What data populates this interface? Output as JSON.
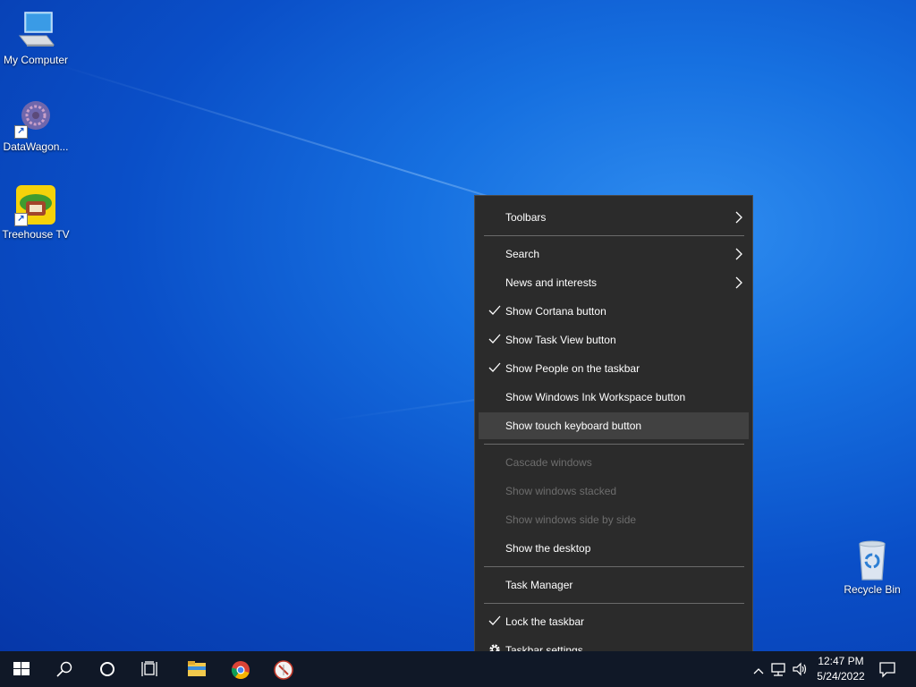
{
  "desktop": {
    "icons": [
      {
        "label": "My Computer",
        "icon": "computer-icon"
      },
      {
        "label": "DataWagon...",
        "icon": "datawagon-icon"
      },
      {
        "label": "Treehouse TV",
        "icon": "treehouse-tv-icon"
      },
      {
        "label": "Recycle Bin",
        "icon": "recycle-bin-icon"
      }
    ]
  },
  "context_menu": {
    "items": [
      {
        "label": "Toolbars",
        "submenu": true
      },
      {
        "label": "Search",
        "submenu": true
      },
      {
        "label": "News and interests",
        "submenu": true
      },
      {
        "label": "Show Cortana button",
        "checked": true
      },
      {
        "label": "Show Task View button",
        "checked": true
      },
      {
        "label": "Show People on the taskbar",
        "checked": true
      },
      {
        "label": "Show Windows Ink Workspace button"
      },
      {
        "label": "Show touch keyboard button",
        "highlighted": true
      },
      {
        "label": "Cascade windows",
        "disabled": true
      },
      {
        "label": "Show windows stacked",
        "disabled": true
      },
      {
        "label": "Show windows side by side",
        "disabled": true
      },
      {
        "label": "Show the desktop"
      },
      {
        "label": "Task Manager"
      },
      {
        "label": "Lock the taskbar",
        "checked": true
      },
      {
        "label": "Taskbar settings",
        "icon": "gear-icon"
      }
    ]
  },
  "taskbar": {
    "buttons": [
      "windows-start-icon",
      "search-icon",
      "cortana-icon",
      "task-view-icon",
      "file-explorer-icon",
      "chrome-icon",
      "app-icon"
    ],
    "tray": {
      "time": "12:47 PM",
      "date": "5/24/2022",
      "icons": [
        "chevron-up-icon",
        "network-icon",
        "volume-icon",
        "notification-icon"
      ]
    }
  },
  "colors": {
    "menu_bg": "#2b2b2b",
    "menu_highlight": "#414141",
    "taskbar_bg": "#101827",
    "desktop_blue": "#1670e0"
  }
}
